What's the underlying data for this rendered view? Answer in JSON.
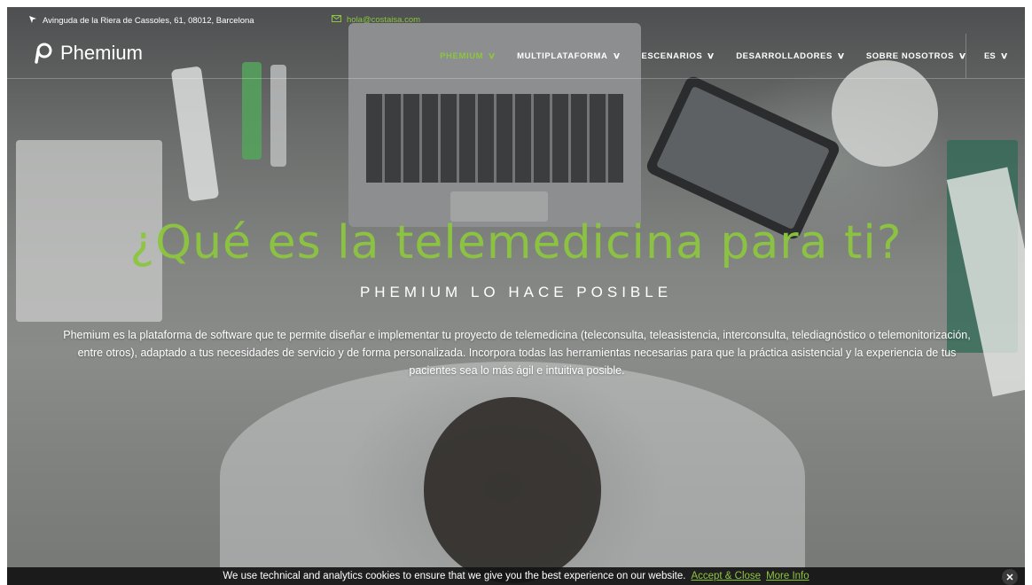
{
  "topbar": {
    "address": "Avinguda de la Riera de Cassoles, 61, 08012, Barcelona",
    "email": "hola@costaisa.com"
  },
  "nav": {
    "logo_text": "Phemium",
    "items": [
      {
        "label": "PHEMIUM",
        "active": true
      },
      {
        "label": "MULTIPLATAFORMA"
      },
      {
        "label": "ESCENARIOS"
      },
      {
        "label": "DESARROLLADORES"
      },
      {
        "label": "SOBRE NOSOTROS"
      }
    ],
    "language": "ES"
  },
  "hero": {
    "title": "¿Qué es la telemedicina para ti?",
    "subtitle": "PHEMIUM LO HACE POSIBLE",
    "description": "Phemium es la plataforma de software que te permite diseñar e implementar tu proyecto de telemedicina (teleconsulta, teleasistencia, interconsulta, telediagnóstico o telemonitorización, entre otros), adaptado a tus necesidades de servicio y de forma personalizada. Incorpora todas las herramientas necesarias para que la práctica asistencial y la experiencia de tus pacientes sea lo más ágil e intuitiva posible."
  },
  "cookie_bar": {
    "message": "We use technical and analytics cookies to ensure that we give you the best experience on our website.",
    "accept_label": "Accept & Close",
    "more_info_label": "More Info",
    "close_label": "✕"
  },
  "colors": {
    "accent": "#8cc63f",
    "text": "#ffffff",
    "cookie_bg": "#141414"
  }
}
